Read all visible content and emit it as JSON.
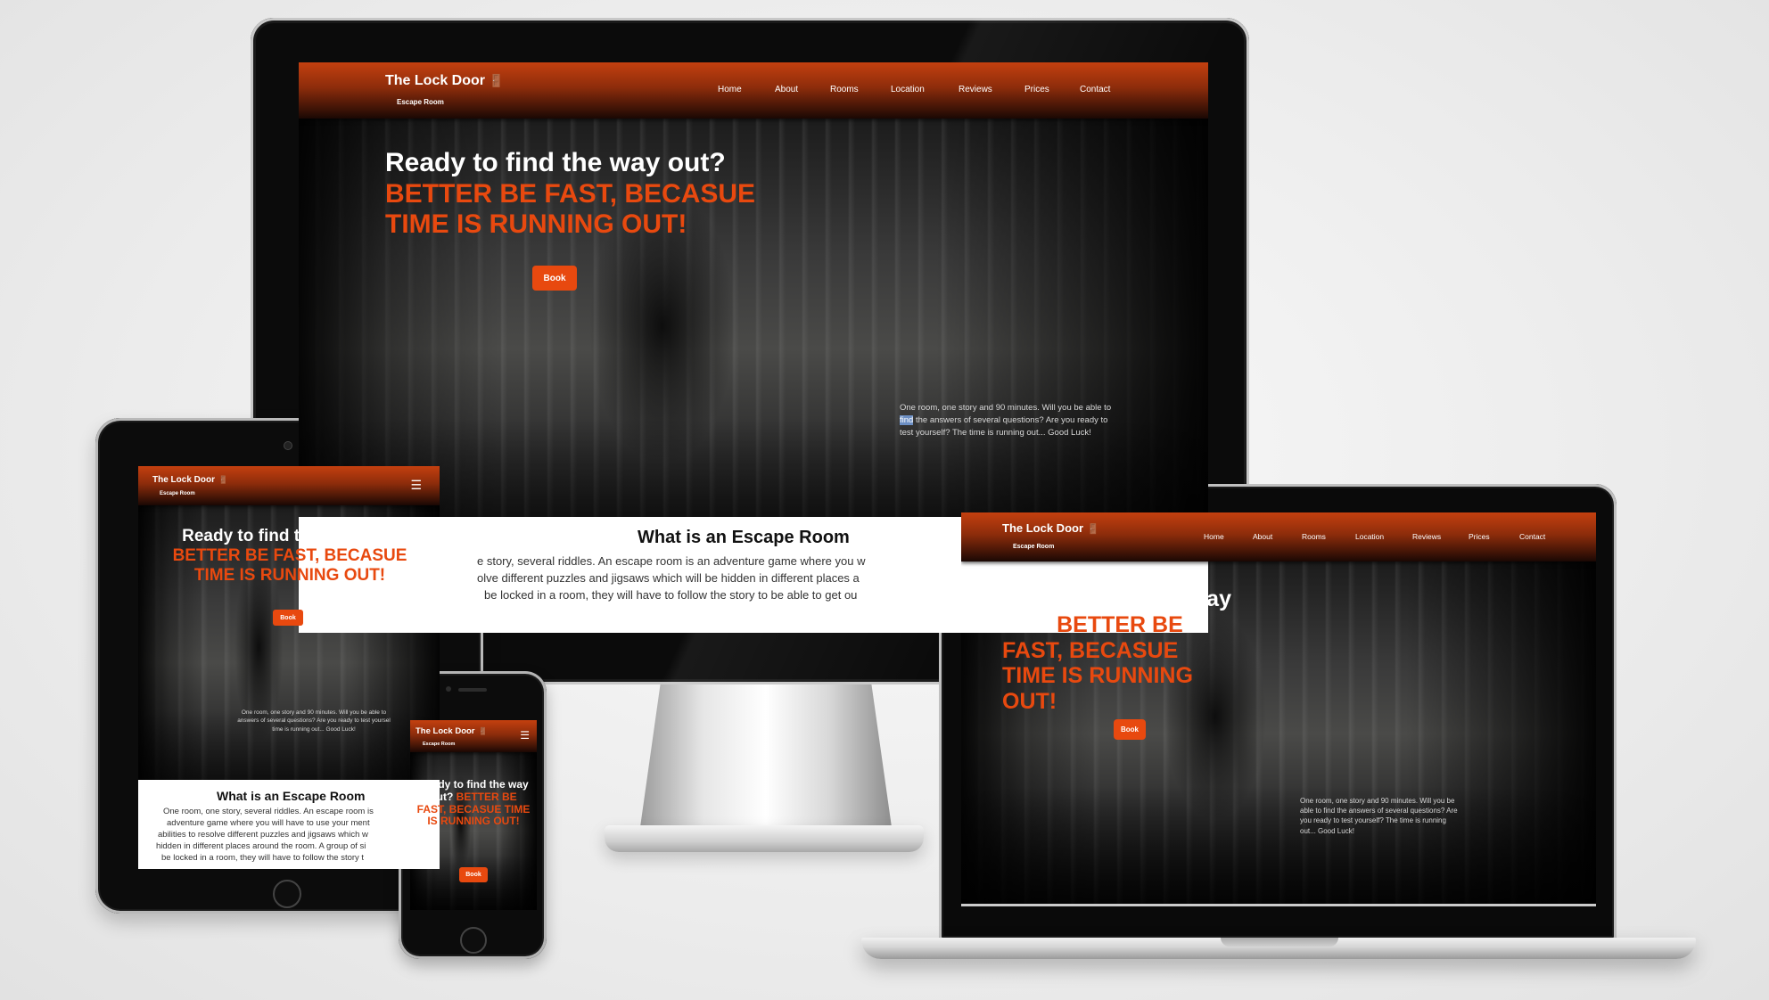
{
  "site": {
    "brand": "The Lock Door",
    "brand_icon": "door-icon",
    "subbrand": "Escape Room",
    "nav": [
      "Home",
      "About",
      "Rooms",
      "Location",
      "Reviews",
      "Prices",
      "Contact"
    ],
    "menu_icon": "hamburger-icon",
    "hero_title_white": "Ready to find the way out?",
    "hero_title_orange": "BETTER BE FAST, BECASUE TIME IS RUNNING OUT!",
    "book_label": "Book",
    "hero_desc": {
      "before": "One room, one story and 90 minutes. Will you be able to ",
      "highlight": "find",
      "after": " the answers of several questions? Are you ready to test yourself? The time is running out... Good Luck!"
    },
    "about_title": "What is an Escape Room",
    "about_text": "One room, one story, several riddles. An escape room is an adventure game where you will have to use your mental abilities to resolve different puzzles and jigsaws which will be hidden in different places around the room. A group of six will be locked in a room, they will have to follow the story to be able to get out"
  },
  "monitor": {
    "about_title": "What is an Escape Room",
    "about_lines": [
      "e story, several riddles. An escape room is an adventure game where you w",
      "olve different puzzles and jigsaws which will be hidden in different places a",
      "be locked in a room, they will have to follow the story to be able to get ou"
    ]
  },
  "tablet": {
    "about_lines": [
      "One room, one story, several riddles. An escape room is",
      "adventure game where you will have to use your ment",
      "abilities to resolve different puzzles and jigsaws which w",
      "hidden in different places around the room. A group of si",
      "be locked in a room, they will have to follow the story t"
    ],
    "hero_desc_lines": [
      "One room, one story and 90 minutes. Will you be able to",
      "answers of several questions? Are you ready to test yoursel",
      "time is running out... Good Luck!"
    ]
  },
  "colors": {
    "accent": "#e8490f",
    "header_top": "#c4400f",
    "header_bottom": "#1a0804",
    "desc_highlight": "#6c8fc4"
  }
}
